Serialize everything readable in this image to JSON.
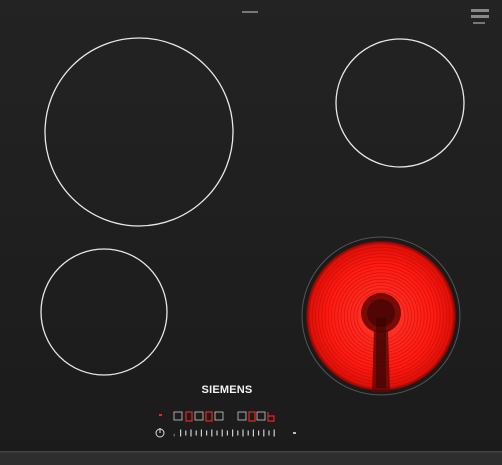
{
  "cooktop": {
    "brand": "SIEMENS",
    "glass_color": "#1f1f1f",
    "frame_color": "#3a3a3a",
    "zone_outline_color": "#e8e8e8",
    "heat_color": "#ff1a14",
    "display_color": "#e8261e",
    "burners": [
      {
        "name": "burner-rear-left",
        "state": "off"
      },
      {
        "name": "burner-rear-right",
        "state": "off"
      },
      {
        "name": "burner-front-left",
        "state": "off"
      },
      {
        "name": "burner-front-right",
        "state": "on"
      }
    ],
    "control_panel": {
      "power_icon": "power-icon",
      "slider_icon": "touch-slider-icon"
    }
  }
}
